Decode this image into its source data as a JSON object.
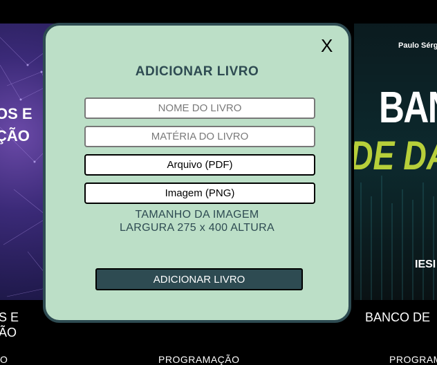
{
  "background": {
    "left_cover": {
      "lines": [
        "OS E",
        "ÇÃO"
      ]
    },
    "right_cover": {
      "author": "Paulo Sérgi",
      "line1": "BAN",
      "line2": "DE DA",
      "logo": "IESI"
    },
    "book_titles": {
      "left_line1": "S E",
      "left_line2": "ÃO",
      "right": "BANCO DE"
    },
    "categories": {
      "left": "O",
      "middle": "PROGRAMAÇÃO",
      "right": "PROGRAM"
    }
  },
  "modal": {
    "close_label": "X",
    "title": "ADICIONAR LIVRO",
    "fields": {
      "name_placeholder": "NOME DO LIVRO",
      "subject_placeholder": "MATÉRIA DO LIVRO",
      "pdf_label": "Arquivo (PDF)",
      "image_label": "Imagem (PNG)"
    },
    "note_line1": "TAMANHO DA IMAGEM",
    "note_line2": "LARGURA 275 x 400 ALTURA",
    "submit_label": "ADICIONAR LIVRO"
  },
  "colors": {
    "modal_bg": "#bcdfc7",
    "accent": "#2e4b52",
    "cover_green": "#b7cf3a"
  }
}
